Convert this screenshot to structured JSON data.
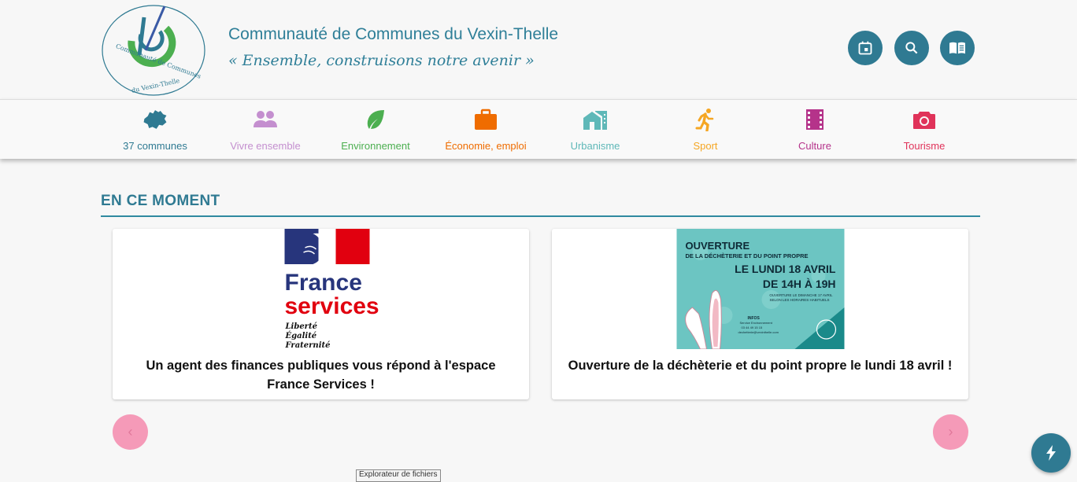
{
  "header": {
    "title": "Communauté de Communes du Vexin-Thelle",
    "motto": "« Ensemble, construisons notre avenir »",
    "logo_text": "Communauté de Communes du Vexin-Thelle",
    "buttons": [
      {
        "icon": "calendar-icon"
      },
      {
        "icon": "search-icon"
      },
      {
        "icon": "book-icon"
      }
    ]
  },
  "nav": {
    "items": [
      {
        "label": "37 communes",
        "icon": "map-icon",
        "color": "#2f7a92"
      },
      {
        "label": "Vivre ensemble",
        "icon": "people-icon",
        "color": "#c48fcf"
      },
      {
        "label": "Environnement",
        "icon": "leaf-icon",
        "color": "#4caf50"
      },
      {
        "label": "Économie, emploi",
        "icon": "briefcase-icon",
        "color": "#ef6c00"
      },
      {
        "label": "Urbanisme",
        "icon": "buildings-icon",
        "color": "#5fb8b8"
      },
      {
        "label": "Sport",
        "icon": "runner-icon",
        "color": "#f5a623"
      },
      {
        "label": "Culture",
        "icon": "film-icon",
        "color": "#b5338a"
      },
      {
        "label": "Tourisme",
        "icon": "camera-icon",
        "color": "#e0335a"
      }
    ]
  },
  "section": {
    "title": "EN CE MOMENT"
  },
  "cards": [
    {
      "caption": "Un agent des finances publiques vous répond à l'espace France Services !",
      "image": {
        "line1": "France",
        "line2": "services",
        "motto1": "Liberté",
        "motto2": "Égalité",
        "motto3": "Fraternité"
      }
    },
    {
      "caption": "Ouverture de la déchèterie et du point propre le lundi 18 avril !",
      "image": {
        "l1": "OUVERTURE",
        "l2": "DE LA DÉCHÈTERIE ET DU POINT PROPRE",
        "l3": "LE LUNDI 18 AVRIL",
        "l4": "DE 14H À 19H",
        "l5": "OUVERTURE LE DIMANCHE 17 AVRIL",
        "l6": "SELON LES HORAIRES HABITUELS",
        "l7": "INFOS",
        "l8": "Service Environnement",
        "l9": "03 44 49 15 15",
        "l10": "dechetterie@vexinthelle.com"
      }
    }
  ],
  "carousel": {
    "prev_label": "‹",
    "next_label": "›"
  },
  "tooltip": "Explorateur de fichiers",
  "colors": {
    "accent": "#2f7a92",
    "arrow": "#f59ab8"
  }
}
